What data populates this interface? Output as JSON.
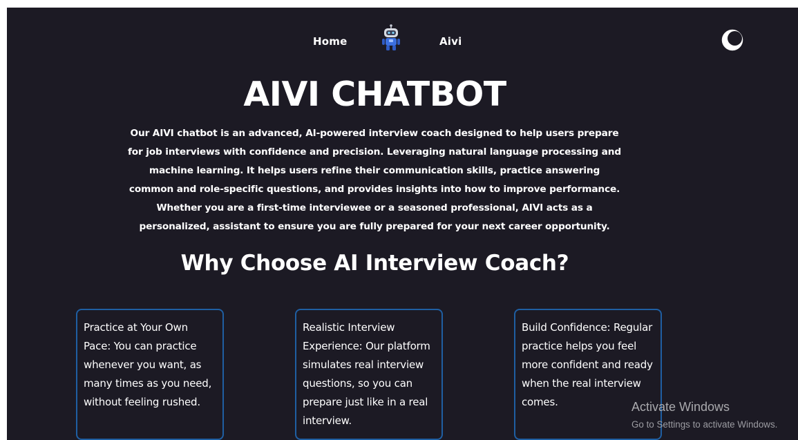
{
  "nav": {
    "home_label": "Home",
    "aivi_label": "Aivi",
    "logo_icon": "robot-icon",
    "theme_icon": "moon-icon"
  },
  "hero": {
    "title": "AIVI CHATBOT",
    "description": "Our AIVI chatbot is an advanced, AI-powered interview coach designed to help users prepare for job interviews with confidence and precision. Leveraging natural language processing and machine learning. It helps users refine their communication skills, practice answering common and role-specific questions, and provides insights into how to improve performance. Whether you are a first-time interviewee or a seasoned professional, AIVI acts as a personalized, assistant to ensure you are fully prepared for your next career opportunity."
  },
  "features": {
    "title": "Why Choose AI Interview Coach?",
    "cards": [
      {
        "text": "Practice at Your Own Pace: You can practice whenever you want, as many times as you need, without feeling rushed."
      },
      {
        "text": "Realistic Interview Experience: Our platform simulates real interview questions, so you can prepare just like in a real interview."
      },
      {
        "text": "Build Confidence: Regular practice helps you feel more confident and ready when the real interview comes."
      }
    ]
  },
  "watermark": {
    "title": "Activate Windows",
    "subtitle": "Go to Settings to activate Windows."
  },
  "colors": {
    "background": "#1c1a24",
    "card_border": "#1f5fa3",
    "text": "#ffffff"
  }
}
